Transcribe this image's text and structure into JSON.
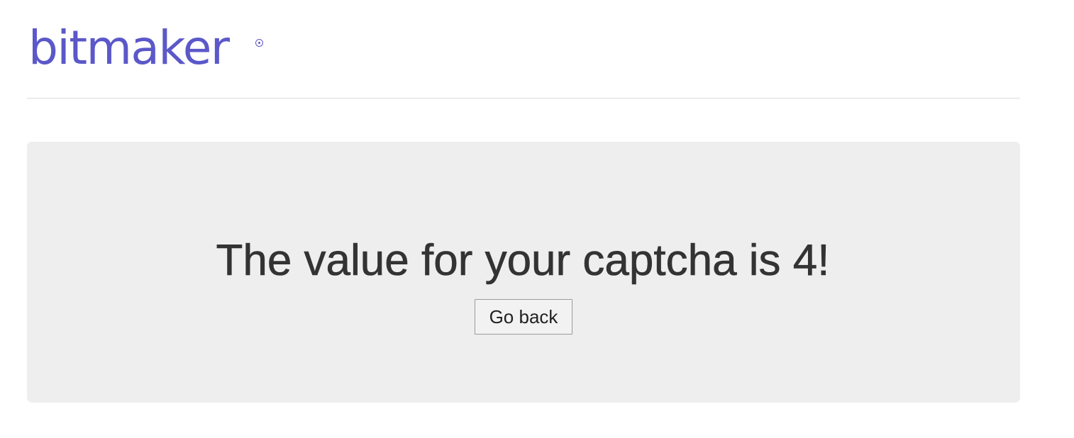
{
  "header": {
    "logo_text": "bitmaker",
    "logo_mark": "registered-trademark-icon",
    "brand_color": "#5b58c9"
  },
  "main": {
    "message": "The value for your captcha is 4!",
    "back_button_label": "Go back",
    "panel_color": "#eeeeee",
    "text_color": "#333333"
  }
}
